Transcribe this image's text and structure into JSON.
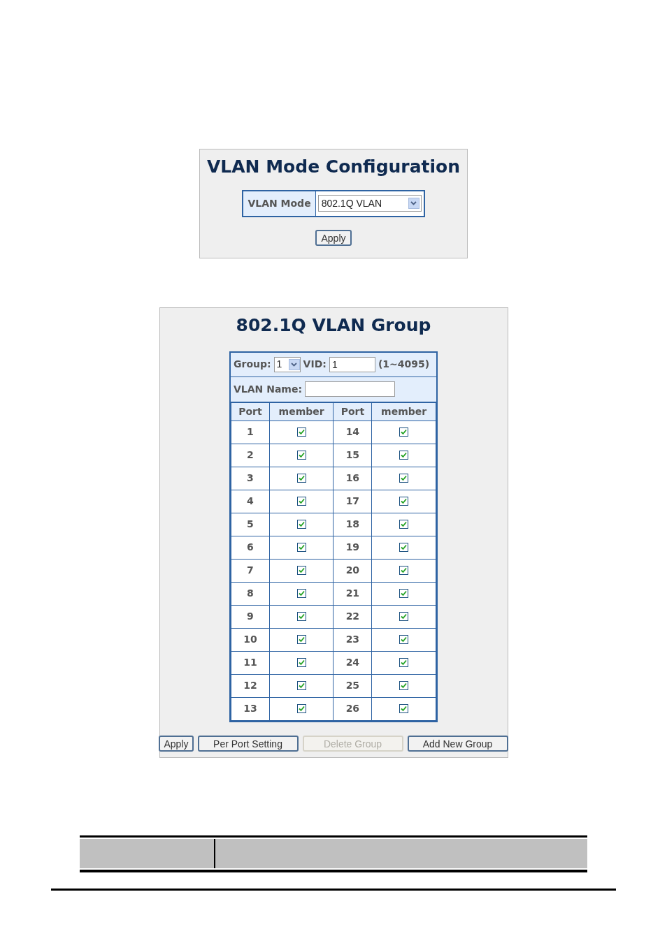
{
  "mode_panel": {
    "title": "VLAN Mode Configuration",
    "label": "VLAN Mode",
    "select_value": "802.1Q VLAN",
    "button": "Apply"
  },
  "group_panel": {
    "title": "802.1Q VLAN Group",
    "group_label": "Group:",
    "group_value": "1",
    "vid_label": "VID:",
    "vid_value": "1",
    "vid_range": "(1~4095)",
    "name_label": "VLAN Name:",
    "columns": [
      "Port",
      "member",
      "Port",
      "member"
    ],
    "ports": [
      {
        "port": "1",
        "member": true
      },
      {
        "port": "2",
        "member": true
      },
      {
        "port": "3",
        "member": true
      },
      {
        "port": "4",
        "member": true
      },
      {
        "port": "5",
        "member": true
      },
      {
        "port": "6",
        "member": true
      },
      {
        "port": "7",
        "member": true
      },
      {
        "port": "8",
        "member": true
      },
      {
        "port": "9",
        "member": true
      },
      {
        "port": "10",
        "member": true
      },
      {
        "port": "11",
        "member": true
      },
      {
        "port": "12",
        "member": true
      },
      {
        "port": "13",
        "member": true
      },
      {
        "port": "14",
        "member": true
      },
      {
        "port": "15",
        "member": true
      },
      {
        "port": "16",
        "member": true
      },
      {
        "port": "17",
        "member": true
      },
      {
        "port": "18",
        "member": true
      },
      {
        "port": "19",
        "member": true
      },
      {
        "port": "20",
        "member": true
      },
      {
        "port": "21",
        "member": true
      },
      {
        "port": "22",
        "member": true
      },
      {
        "port": "23",
        "member": true
      },
      {
        "port": "24",
        "member": true
      },
      {
        "port": "25",
        "member": true
      },
      {
        "port": "26",
        "member": true
      }
    ],
    "buttons": [
      {
        "label": "Apply",
        "disabled": false
      },
      {
        "label": "Per Port Setting",
        "disabled": false
      },
      {
        "label": "Delete Group",
        "disabled": true
      },
      {
        "label": "Add New Group",
        "disabled": false
      }
    ]
  }
}
